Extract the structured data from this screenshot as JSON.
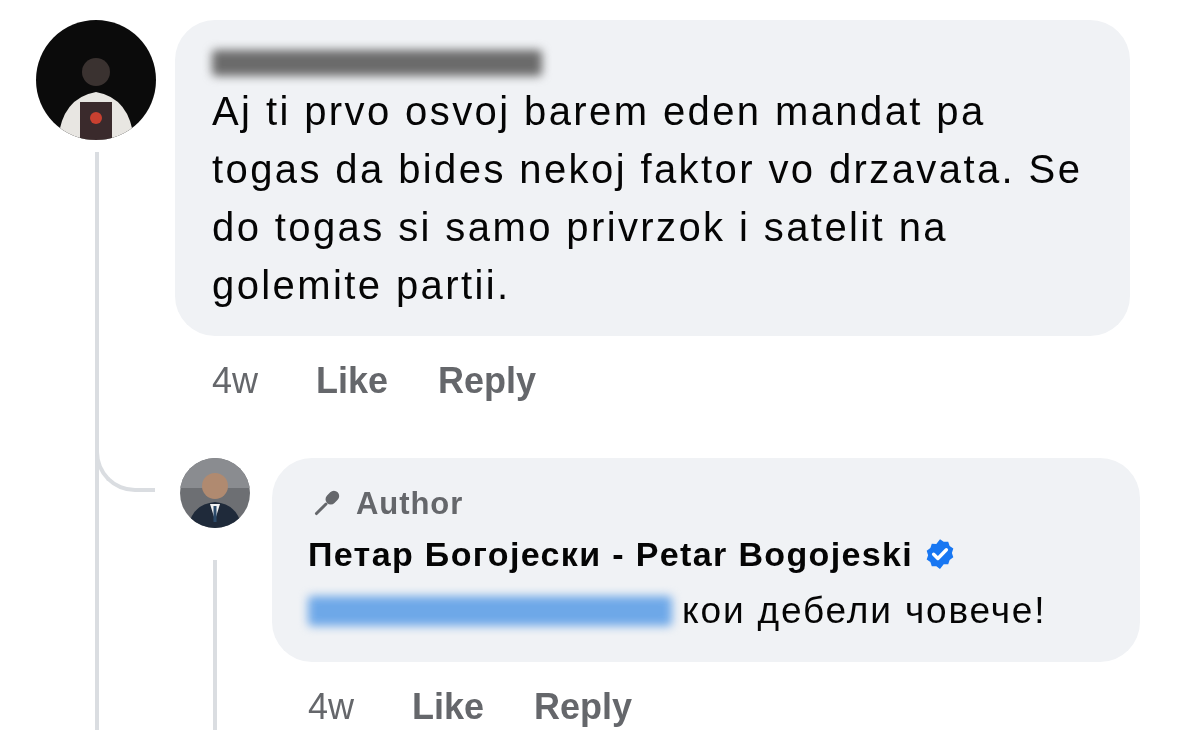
{
  "comments": [
    {
      "text": "Aj ti prvo osvoj barem eden mandat pa togas da bides nekoj faktor vo drzavata. Se do togas si samo privrzok i satelit na golemite partii.",
      "time": "4w",
      "actions": [
        "Like",
        "Reply"
      ]
    },
    {
      "author_badge": "Author",
      "author": "Петар Богојески - Petar Bogojeski",
      "verified": true,
      "text": "кои дебели човече!",
      "actions": [
        "Like",
        "Reply"
      ],
      "time": "4w"
    }
  ]
}
